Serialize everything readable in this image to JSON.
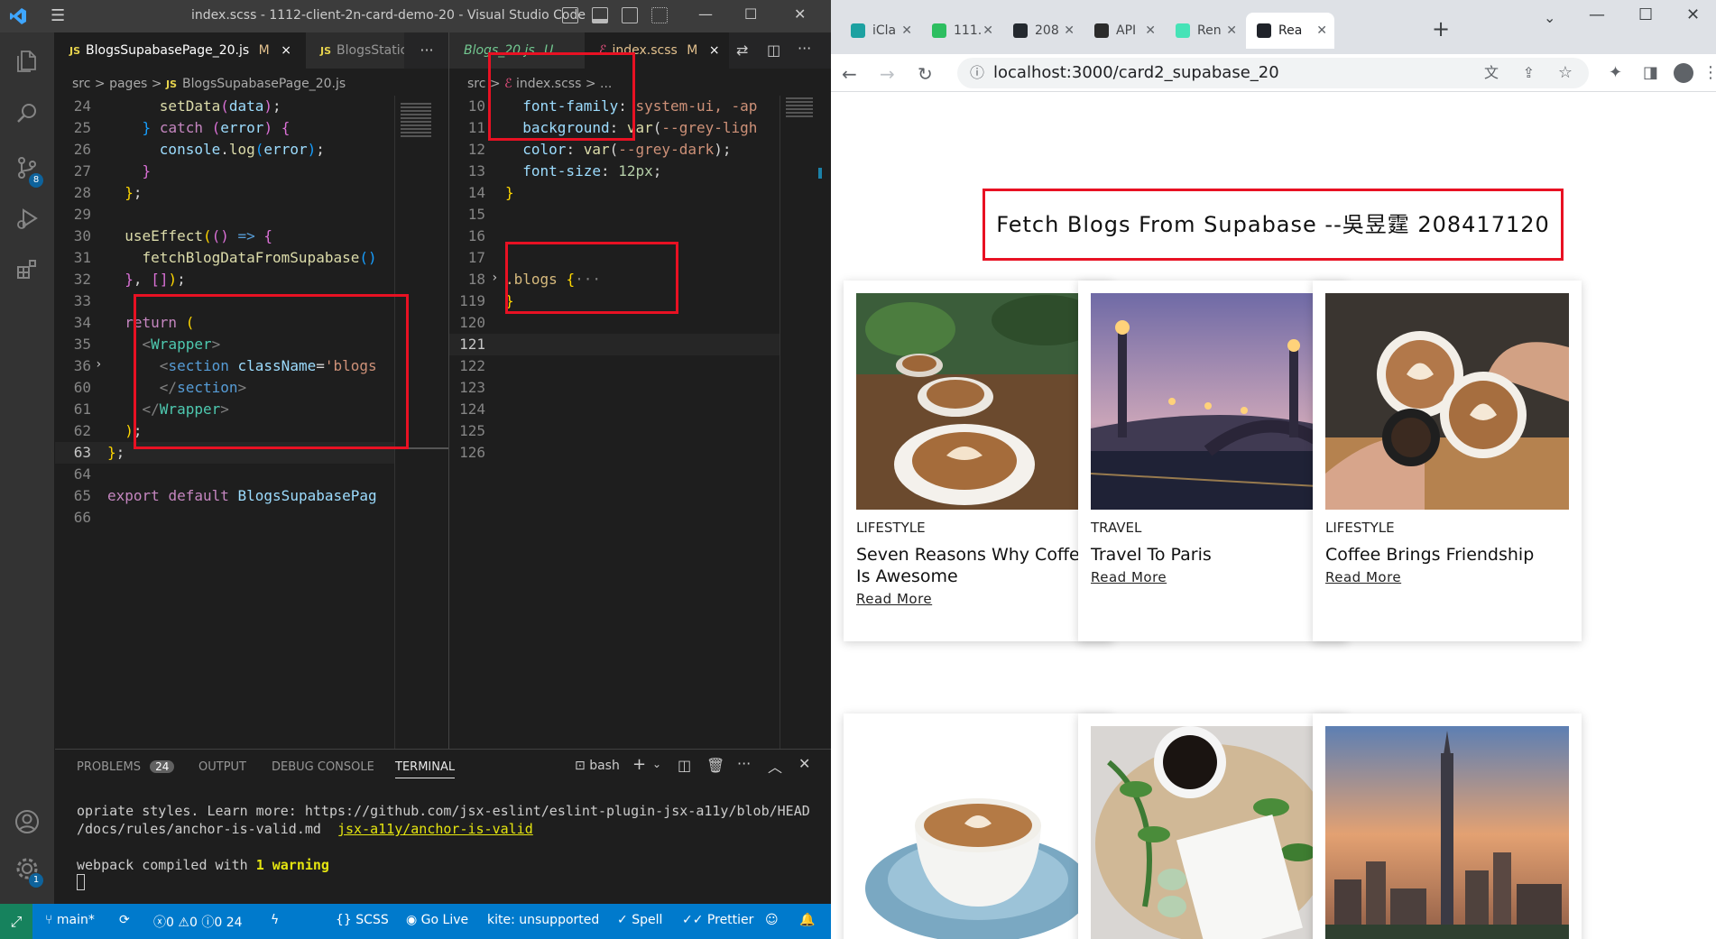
{
  "vscode": {
    "window_title": "index.scss - 1112-client-2n-card-demo-20 - Visual Studio Code",
    "activity_badges": {
      "source_control": "8",
      "settings": "1"
    },
    "left_group": {
      "tabs": [
        {
          "label": "BlogsSupabasePage_20.js",
          "flag": "M",
          "close": "×"
        },
        {
          "label": "BlogsStatic",
          "flag": "",
          "close": ""
        }
      ],
      "more": "···",
      "breadcrumb": [
        "src",
        "pages",
        "BlogsSupabasePage_20.js"
      ],
      "lines": [
        {
          "n": "24",
          "html": "      <span class='fn'>setData</span><span class='br2'>(</span><span class='var'>data</span><span class='br2'>)</span><span class='def'>;</span>"
        },
        {
          "n": "25",
          "html": "    <span class='br3'>}</span> <span class='kw'>catch</span> <span class='br2'>(</span><span class='var'>error</span><span class='br2'>)</span> <span class='br2'>{</span>"
        },
        {
          "n": "26",
          "html": "      <span class='var'>console</span><span class='def'>.</span><span class='fn'>log</span><span class='br3'>(</span><span class='var'>error</span><span class='br3'>)</span><span class='def'>;</span>"
        },
        {
          "n": "27",
          "html": "    <span class='br2'>}</span>"
        },
        {
          "n": "28",
          "html": "  <span class='br'>}</span><span class='def'>;</span>"
        },
        {
          "n": "29",
          "html": ""
        },
        {
          "n": "30",
          "html": "  <span class='fn'>useEffect</span><span class='br'>(</span><span class='br2'>()</span> <span class='blue'>=&gt;</span> <span class='br2'>{</span>"
        },
        {
          "n": "31",
          "html": "    <span class='fn'>fetchBlogDataFromSupabase</span><span class='br3'>()</span>"
        },
        {
          "n": "32",
          "html": "  <span class='br2'>}</span><span class='def'>,</span> <span class='br2'>[]</span><span class='br'>)</span><span class='def'>;</span>"
        },
        {
          "n": "33",
          "html": ""
        },
        {
          "n": "34",
          "html": "  <span class='kw'>return</span> <span class='br'>(</span>"
        },
        {
          "n": "35",
          "html": "    <span class='pun'>&lt;</span><span class='tag'>Wrapper</span><span class='pun'>&gt;</span>"
        },
        {
          "n": "36",
          "html": "      <span class='pun'>&lt;</span><span class='blue'>section</span> <span class='var'>className</span><span class='def'>=</span><span class='str'>'blogs</span>"
        },
        {
          "n": "60",
          "html": "      <span class='pun'>&lt;/</span><span class='blue'>section</span><span class='pun'>&gt;</span>"
        },
        {
          "n": "61",
          "html": "    <span class='pun'>&lt;/</span><span class='tag'>Wrapper</span><span class='pun'>&gt;</span>"
        },
        {
          "n": "62",
          "html": "  <span class='br'>)</span><span class='def'>;</span>"
        },
        {
          "n": "63",
          "html": "<span class='br'>}</span><span class='def'>;</span>"
        },
        {
          "n": "64",
          "html": ""
        },
        {
          "n": "65",
          "html": "<span class='kw'>export</span> <span class='kw'>default</span> <span class='var'>BlogsSupabasePag</span>"
        },
        {
          "n": "66",
          "html": ""
        }
      ]
    },
    "right_group": {
      "tabs": [
        {
          "label": "Blogs_20.js",
          "flag": "U"
        },
        {
          "label": "index.scss",
          "flag": "M",
          "close": "×"
        }
      ],
      "breadcrumb": [
        "src",
        "index.scss",
        "..."
      ],
      "lines": [
        {
          "n": "10",
          "html": "  <span class='prop'>font-family</span><span class='def'>:</span> <span class='str'>system-ui, -ap</span>"
        },
        {
          "n": "11",
          "html": "  <span class='prop'>background</span><span class='def'>:</span> <span class='fn'>var</span><span class='def'>(</span><span class='str'>--grey-ligh</span>"
        },
        {
          "n": "12",
          "html": "  <span class='prop'>color</span><span class='def'>:</span> <span class='fn'>var</span><span class='def'>(</span><span class='str'>--grey-dark</span><span class='def'>);</span>"
        },
        {
          "n": "13",
          "html": "  <span class='prop'>font-size</span><span class='def'>:</span> <span class='num'>12px</span><span class='def'>;</span>"
        },
        {
          "n": "14",
          "html": "<span class='br'>}</span>"
        },
        {
          "n": "15",
          "html": ""
        },
        {
          "n": "16",
          "html": ""
        },
        {
          "n": "17",
          "html": ""
        },
        {
          "n": "18",
          "html": "<span class='sel'>.blogs</span> <span class='br'>{</span><span class='pun'>···</span>"
        },
        {
          "n": "119",
          "html": "<span class='br'>}</span>"
        },
        {
          "n": "120",
          "html": ""
        },
        {
          "n": "121",
          "html": ""
        },
        {
          "n": "122",
          "html": ""
        },
        {
          "n": "123",
          "html": ""
        },
        {
          "n": "124",
          "html": ""
        },
        {
          "n": "125",
          "html": ""
        },
        {
          "n": "126",
          "html": ""
        }
      ]
    },
    "panel": {
      "tabs": [
        "PROBLEMS",
        "OUTPUT",
        "DEBUG CONSOLE",
        "TERMINAL"
      ],
      "problems_count": "24",
      "shell": "bash",
      "terminal_lines": [
        "opriate styles. Learn more: https://github.com/jsx-eslint/eslint-plugin-jsx-a11y/blob/HEAD",
        "/docs/rules/anchor-is-valid.md"
      ],
      "rule_link": "jsx-a11y/anchor-is-valid",
      "compiled_prefix": "webpack compiled with ",
      "compiled_warning": "1 warning"
    },
    "status": {
      "branch": "main*",
      "errors": "0",
      "warnings": "0",
      "infos": "0",
      "info_count": "24",
      "lang": "SCSS",
      "golive": "Go Live",
      "kite": "kite: unsupported",
      "spell": "Spell",
      "prettier": "Prettier"
    }
  },
  "browser": {
    "tabs": [
      {
        "label": "iCla",
        "color": "#1da1a1"
      },
      {
        "label": "111.",
        "color": "#2dbe60"
      },
      {
        "label": "208",
        "color": "#24292f"
      },
      {
        "label": "API",
        "color": "#2b2b2b"
      },
      {
        "label": "Ren",
        "color": "#46e3b7"
      },
      {
        "label": "Rea",
        "color": "#20232a"
      }
    ],
    "url": "localhost:3000/card2_supabase_20",
    "page": {
      "title": "Fetch Blogs From Supabase --吳昱霆 208417120",
      "cards": [
        {
          "category": "LIFESTYLE",
          "title": "Seven Reasons Why Coffee Is Awesome",
          "more": "Read More"
        },
        {
          "category": "TRAVEL",
          "title": "Travel To Paris",
          "more": "Read More"
        },
        {
          "category": "LIFESTYLE",
          "title": "Coffee Brings Friendship",
          "more": "Read More"
        }
      ]
    }
  }
}
